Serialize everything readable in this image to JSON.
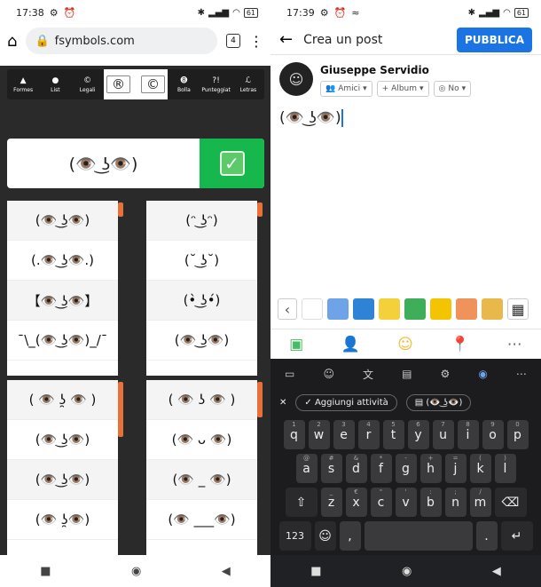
{
  "left": {
    "status": {
      "time": "17:38",
      "battery": "61"
    },
    "url": "fsymbols.com",
    "tab_count": "4",
    "categories": [
      {
        "glyph": "▲",
        "label": "Formes"
      },
      {
        "glyph": "●",
        "label": "List"
      },
      {
        "glyph": "©",
        "label": "Legali"
      },
      {
        "glyph": "®",
        "label": ""
      },
      {
        "glyph": "©",
        "label": ""
      },
      {
        "glyph": "➑",
        "label": "Bolla"
      },
      {
        "glyph": "?!",
        "label": "Punteggiat"
      },
      {
        "glyph": "ℒ",
        "label": "Letras"
      }
    ],
    "preview_text": "(👁️ ͜ʖ👁️)",
    "check_glyph": "✓",
    "col1a": [
      "(👁️ ͜ʖ👁️)",
      "(.👁️ ͜ʖ👁️.)",
      "【👁️ ͜ʖ👁️】",
      "¯\\_(👁️ ͜ʖ👁️)_/¯"
    ],
    "col2a": [
      "(ᵔ ͜ʖᵔ)",
      "(˘ ͜ʖ˘)",
      "(•̀ ͜ʖ•́)",
      "(👁️ ͜ʖ👁️)"
    ],
    "col1b": [
      "( 👁️ ʖ̯ 👁️ )",
      "(👁️ ͜ʖ👁️)",
      "(👁️ ͜ʖ👁️)",
      "(👁️ ʖ̯👁️)"
    ],
    "col2b": [
      "( 👁️ ʖ 👁️ )",
      "(👁️ ᴗ 👁️)",
      "(👁️ _ 👁️)",
      "(👁️ ___👁️)"
    ]
  },
  "right": {
    "status": {
      "time": "17:39",
      "battery": "61"
    },
    "title": "Crea un post",
    "publish": "PUBBLICA",
    "user": "Giuseppe Servidio",
    "chips": [
      "Amici",
      "Album",
      "No"
    ],
    "post_text": "(👁️ ͜ʖ👁️)",
    "sugg_add": "Aggiungi attività",
    "sugg_clip": "(👁️ ͜ʖ👁️)",
    "row1": [
      [
        "q",
        "1"
      ],
      [
        "w",
        "2"
      ],
      [
        "e",
        "3"
      ],
      [
        "r",
        "4"
      ],
      [
        "t",
        "5"
      ],
      [
        "y",
        "6"
      ],
      [
        "u",
        "7"
      ],
      [
        "i",
        "8"
      ],
      [
        "o",
        "9"
      ],
      [
        "p",
        "0"
      ]
    ],
    "row2": [
      [
        "a",
        "@"
      ],
      [
        "s",
        "#"
      ],
      [
        "d",
        "&"
      ],
      [
        "f",
        "*"
      ],
      [
        "g",
        "-"
      ],
      [
        "h",
        "+"
      ],
      [
        "j",
        "="
      ],
      [
        "k",
        "("
      ],
      [
        "l",
        ")"
      ]
    ],
    "row3": [
      [
        "z",
        "_"
      ],
      [
        "x",
        "€"
      ],
      [
        "c",
        "\""
      ],
      [
        "v",
        "'"
      ],
      [
        "b",
        ":"
      ],
      [
        "n",
        ";"
      ],
      [
        "m",
        "/"
      ]
    ],
    "num_key": "123",
    "comma_key": ",",
    "period_key": "."
  },
  "colors": {
    "accent": "#1b74e4",
    "check_bg": "#16b84e"
  }
}
